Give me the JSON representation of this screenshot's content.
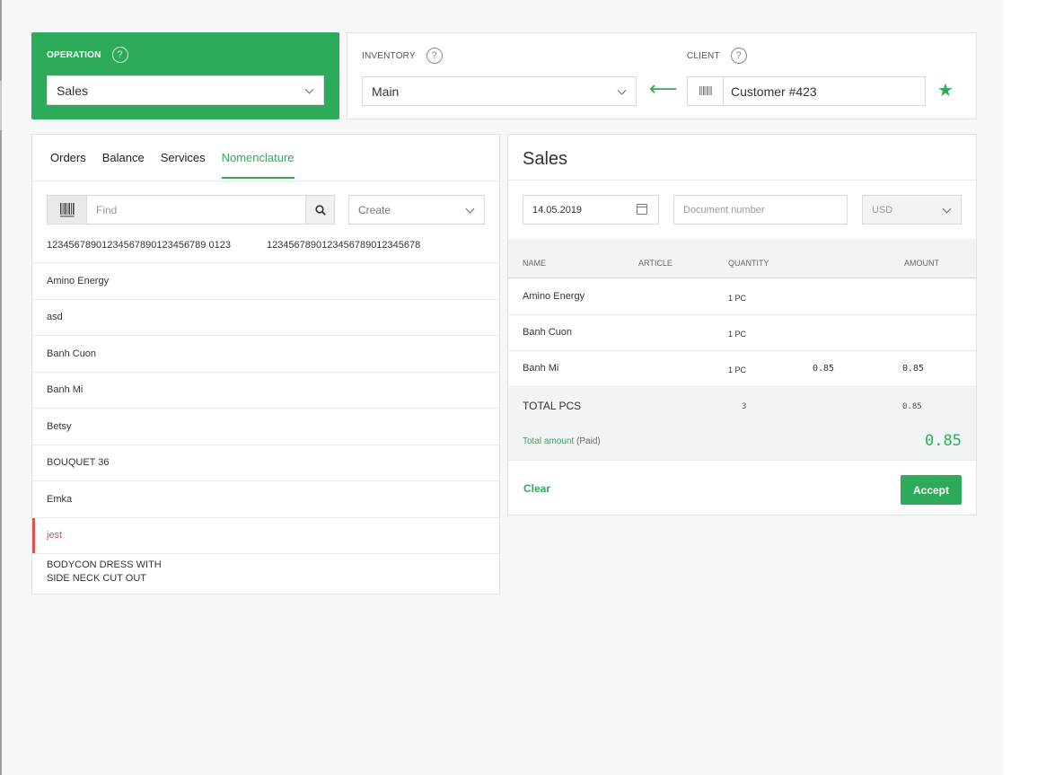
{
  "operation": {
    "label": "OPERATION",
    "value": "Sales"
  },
  "inventory": {
    "label": "INVENTORY",
    "value": "Main"
  },
  "client": {
    "label": "CLIENT",
    "value": "Customer #423"
  },
  "help_symbol": "?",
  "arrow_symbol": "⟵",
  "star_symbol": "★",
  "tabs": [
    "Orders",
    "Balance",
    "Services",
    "Nomenclature"
  ],
  "search": {
    "placeholder": "Find"
  },
  "create": {
    "label": "Create"
  },
  "codes": [
    "12345678901234567890123456789 0123",
    "1234567890123456789012345678"
  ],
  "products": [
    "Amino Energy",
    "asd",
    "Banh Cuon",
    "Banh Mi",
    "Betsy",
    "BOUQUET 36",
    "Emka",
    "jest",
    "BODYCON DRESS WITH\nSIDE NECK CUT OUT"
  ],
  "sales": {
    "title": "Sales",
    "date": "14.05.2019",
    "document_placeholder": "Document number",
    "currency": "USD",
    "headers": {
      "name": "NAME",
      "article": "ARTICLE",
      "quantity": "QUANTITY",
      "amount": "AMOUNT"
    },
    "rows": [
      {
        "name": "Amino Energy",
        "qty": "1 PC",
        "price": "",
        "amount": ""
      },
      {
        "name": "Banh Cuon",
        "qty": "1 PC",
        "price": "",
        "amount": ""
      },
      {
        "name": "Banh Mi",
        "qty": "1 PC",
        "price": "0.85",
        "amount": "0.85"
      }
    ],
    "total_pcs_label": "TOTAL PCS",
    "total_pcs": "3",
    "total_pcs_amount": "0.85",
    "total_amount_label": "Total amount",
    "total_paid": "(Paid)",
    "total_amount": "0.85",
    "clear": "Clear",
    "accept": "Accept"
  },
  "colors": {
    "accent": "#2eab5a",
    "alert": "#e05050"
  }
}
